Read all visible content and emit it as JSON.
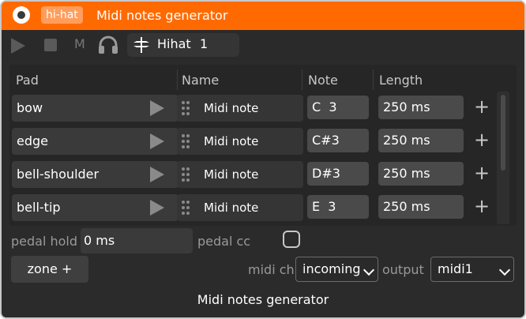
{
  "titlebar": {
    "badge": "hi-hat",
    "title": "Midi notes generator",
    "bg_color": "#ff6a00"
  },
  "toolbar": {
    "mute_label": "M",
    "track_name": "Hihat",
    "track_number": "1"
  },
  "table": {
    "headers": {
      "pad": "Pad",
      "name": "Name",
      "note": "Note",
      "length": "Length"
    },
    "rows": [
      {
        "pad": "bow",
        "name": "Midi note",
        "note": "C  3",
        "length": "250 ms"
      },
      {
        "pad": "edge",
        "name": "Midi note",
        "note": "C#3",
        "length": "250 ms"
      },
      {
        "pad": "bell-shoulder",
        "name": "Midi note",
        "note": "D#3",
        "length": "250 ms"
      },
      {
        "pad": "bell-tip",
        "name": "Midi note",
        "note": "E  3",
        "length": "250 ms"
      }
    ],
    "add_symbol": "+"
  },
  "controls": {
    "pedal_hold_label": "pedal hold",
    "pedal_hold_value": "0 ms",
    "pedal_cc_label": "pedal cc",
    "zone_button": "zone +",
    "midi_ch_label": "midi ch",
    "midi_ch_value": "incoming",
    "output_label": "output",
    "output_value": "midi1"
  },
  "footer": {
    "title": "Midi notes generator"
  }
}
